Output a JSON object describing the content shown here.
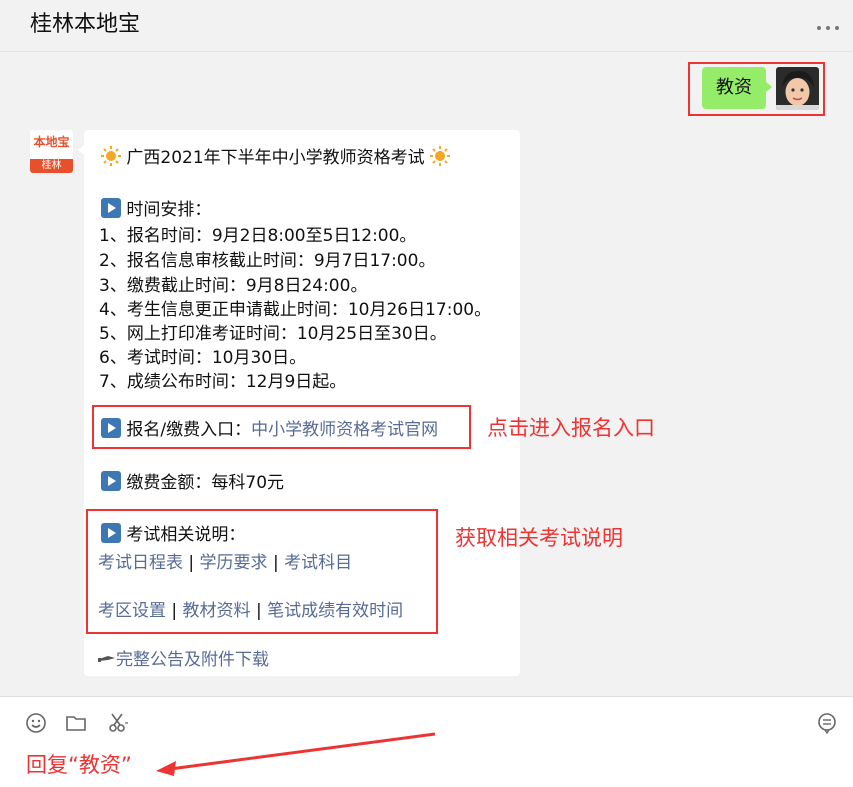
{
  "header": {
    "title": "桂林本地宝"
  },
  "outgoing": {
    "message": "教资"
  },
  "bot": {
    "brand": "本地宝",
    "tag": "桂林"
  },
  "card": {
    "title": "广西2021年下半年中小学教师资格考试",
    "schedule_heading": "时间安排：",
    "schedule": [
      "1、报名时间：9月2日8:00至5日12:00。",
      "2、报名信息审核截止时间：9月7日17:00。",
      "3、缴费截止时间：9月8日24:00。",
      "4、考生信息更正申请截止时间：10月26日17:00。",
      "5、网上打印准考证时间：10月25日至30日。",
      "6、考试时间：10月30日。",
      "7、成绩公布时间：12月9日起。"
    ],
    "entry_label": "报名/缴费入口：",
    "entry_link": "中小学教师资格考试官网",
    "fee": "缴费金额：每科70元",
    "notes_heading": "考试相关说明：",
    "notes_links_row1": [
      "考试日程表",
      "学历要求",
      "考试科目"
    ],
    "notes_links_row2": [
      "考区设置",
      "教材资料",
      "笔试成绩有效时间"
    ],
    "download": "完整公告及附件下载"
  },
  "annotations": {
    "entry": "点击进入报名入口",
    "notes": "获取相关考试说明",
    "reply": "回复“教资”"
  },
  "colors": {
    "annotation": "#e33333",
    "link": "#576b95",
    "bubble_out": "#95ec69"
  }
}
